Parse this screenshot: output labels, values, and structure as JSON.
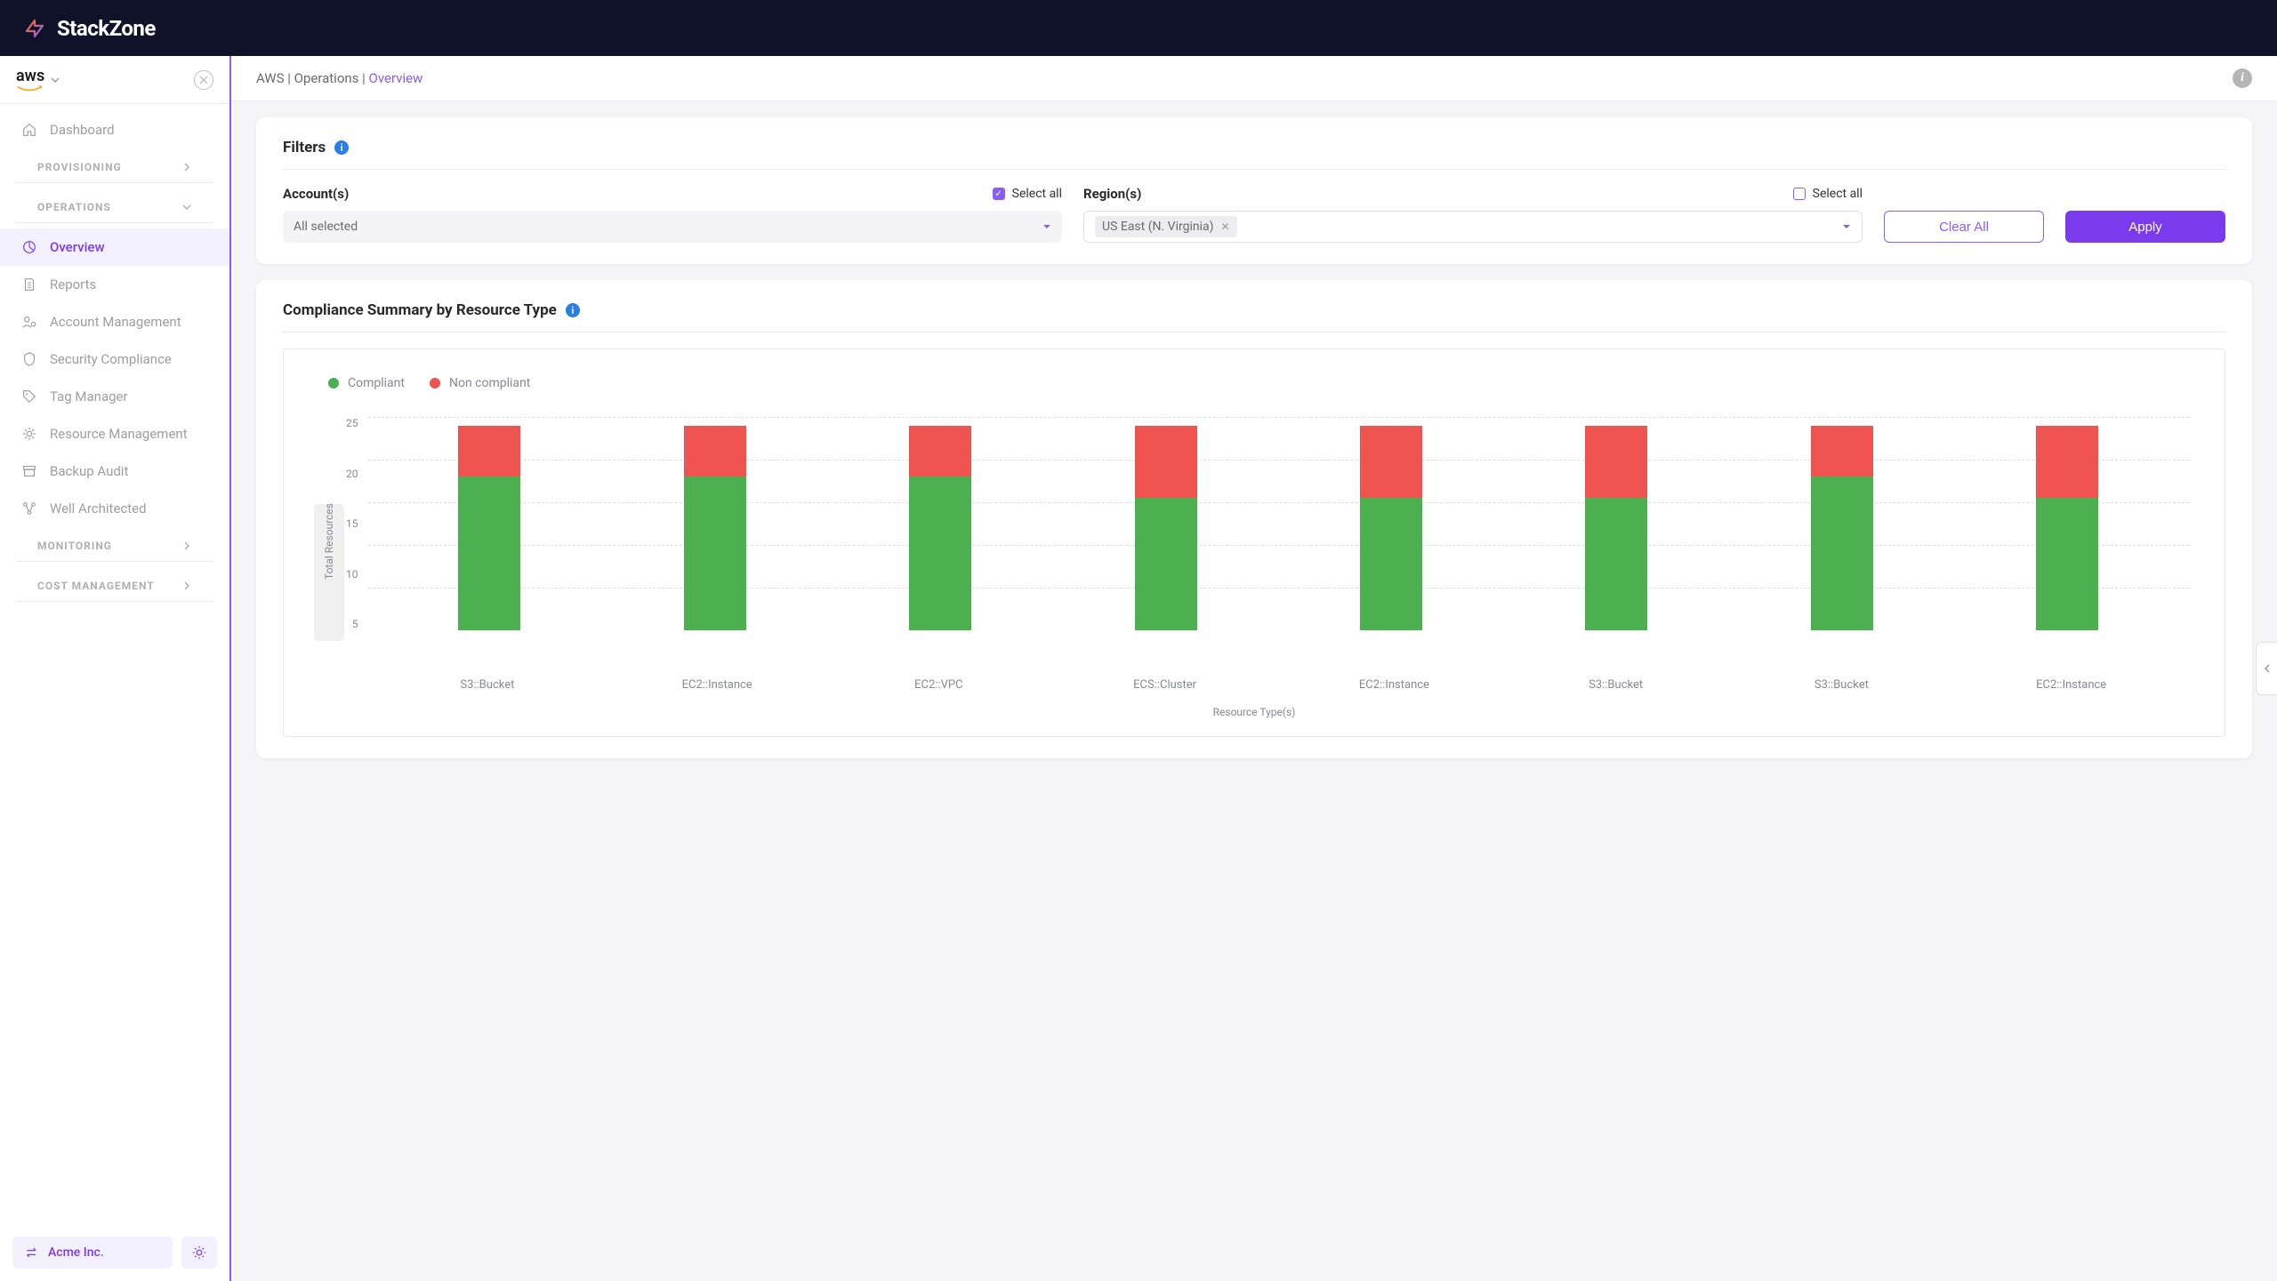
{
  "brand": "StackZone",
  "cloud_provider": "aws",
  "breadcrumb": {
    "part1": "AWS",
    "part2": "Operations",
    "current": "Overview"
  },
  "sidebar": {
    "dashboard": "Dashboard",
    "sections": {
      "provisioning": "PROVISIONING",
      "operations": "OPERATIONS",
      "monitoring": "MONITORING",
      "cost": "COST MANAGEMENT"
    },
    "operations_items": [
      "Overview",
      "Reports",
      "Account Management",
      "Security Compliance",
      "Tag Manager",
      "Resource Management",
      "Backup Audit",
      "Well Architected"
    ],
    "org": "Acme Inc."
  },
  "filters": {
    "title": "Filters",
    "accounts_label": "Account(s)",
    "accounts_value": "All selected",
    "accounts_select_all": "Select all",
    "regions_label": "Region(s)",
    "regions_select_all": "Select all",
    "regions_chip": "US East (N. Virginia)",
    "clear": "Clear All",
    "apply": "Apply"
  },
  "compliance": {
    "title": "Compliance Summary by Resource Type",
    "legend_compliant": "Compliant",
    "legend_noncompliant": "Non compliant",
    "y_label": "Total Resources",
    "x_label": "Resource Type(s)"
  },
  "chart_data": {
    "type": "bar",
    "stacked": true,
    "categories": [
      "S3::Bucket",
      "EC2::Instance",
      "EC2::VPC",
      "ECS::Cluster",
      "EC2::Instance",
      "S3::Bucket",
      "S3::Bucket",
      "EC2::Instance"
    ],
    "series": [
      {
        "name": "Compliant",
        "color": "#4caf50",
        "values": [
          18,
          18,
          18,
          15.5,
          15.5,
          15.5,
          18,
          15.5
        ]
      },
      {
        "name": "Non compliant",
        "color": "#ef5350",
        "values": [
          6,
          6,
          6,
          8.5,
          8.5,
          8.5,
          6,
          8.5
        ]
      }
    ],
    "ylim": [
      0,
      25
    ],
    "yticks": [
      25,
      20,
      15,
      10,
      5
    ],
    "ylabel": "Total Resources",
    "xlabel": "Resource Type(s)",
    "legend_position": "top-left",
    "grid": true
  }
}
